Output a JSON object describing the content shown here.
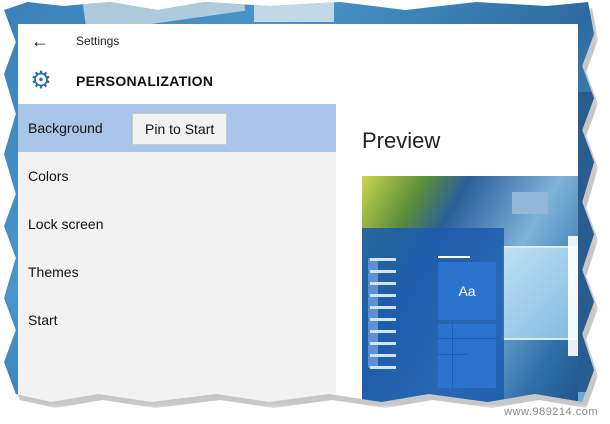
{
  "window": {
    "title": "Settings",
    "back_icon": "back-arrow-icon",
    "header": {
      "icon": "gear-icon",
      "title": "PERSONALIZATION"
    }
  },
  "nav": {
    "items": [
      {
        "label": "Background",
        "selected": true
      },
      {
        "label": "Colors",
        "selected": false
      },
      {
        "label": "Lock screen",
        "selected": false
      },
      {
        "label": "Themes",
        "selected": false
      },
      {
        "label": "Start",
        "selected": false
      }
    ],
    "pin_button": "Pin to Start"
  },
  "content": {
    "title": "Preview",
    "preview_tile_text": "Aa"
  },
  "watermark": "www.989214.com",
  "colors": {
    "selection": "#a8c4e6",
    "accent": "#2b6cb5",
    "window_bg": "#f2f2f2"
  }
}
